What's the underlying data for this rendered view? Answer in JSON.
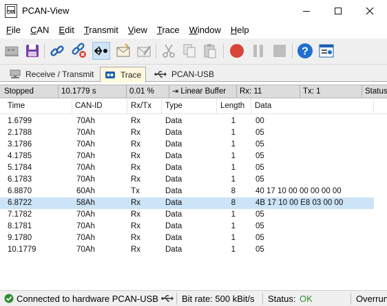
{
  "window": {
    "title": "PCAN-View",
    "app_icon_text": "CAN"
  },
  "menu": [
    {
      "label_u": "F",
      "label_rest": "ile"
    },
    {
      "label_u": "C",
      "label_rest": "AN"
    },
    {
      "label_u": "E",
      "label_rest": "dit"
    },
    {
      "label_u": "T",
      "label_rest": "ransmit"
    },
    {
      "label_u": "V",
      "label_rest": "iew"
    },
    {
      "label_u": "T",
      "label_rest": "race"
    },
    {
      "label_u": "W",
      "label_rest": "indow"
    },
    {
      "label_u": "H",
      "label_rest": "elp"
    }
  ],
  "tabs": {
    "receive_transmit": "Receive / Transmit",
    "trace": "Trace",
    "pcan_usb": "PCAN-USB"
  },
  "trace_status": {
    "state": "Stopped",
    "elapsed": "10.1779 s",
    "buffer_usage": "0.01 %",
    "buffer_mode": "Linear Buffer",
    "rx": "Rx: 11",
    "tx": "Tx: 1",
    "status": "Status"
  },
  "table": {
    "headers": {
      "time": "Time",
      "can_id": "CAN-ID",
      "rx_tx": "Rx/Tx",
      "type": "Type",
      "length": "Length",
      "data": "Data"
    },
    "rows": [
      {
        "time": "1.6799",
        "id": "70Ah",
        "dir": "Rx",
        "type": "Data",
        "len": "1",
        "data": "00"
      },
      {
        "time": "2.1788",
        "id": "70Ah",
        "dir": "Rx",
        "type": "Data",
        "len": "1",
        "data": "05"
      },
      {
        "time": "3.1786",
        "id": "70Ah",
        "dir": "Rx",
        "type": "Data",
        "len": "1",
        "data": "05"
      },
      {
        "time": "4.1785",
        "id": "70Ah",
        "dir": "Rx",
        "type": "Data",
        "len": "1",
        "data": "05"
      },
      {
        "time": "5.1784",
        "id": "70Ah",
        "dir": "Rx",
        "type": "Data",
        "len": "1",
        "data": "05"
      },
      {
        "time": "6.1783",
        "id": "70Ah",
        "dir": "Rx",
        "type": "Data",
        "len": "1",
        "data": "05"
      },
      {
        "time": "6.8870",
        "id": "60Ah",
        "dir": "Tx",
        "type": "Data",
        "len": "8",
        "data": "40 17 10 00 00 00 00 00"
      },
      {
        "time": "6.8722",
        "id": "58Ah",
        "dir": "Rx",
        "type": "Data",
        "len": "8",
        "data": "4B 17 10 00 E8 03 00 00"
      },
      {
        "time": "7.1782",
        "id": "70Ah",
        "dir": "Rx",
        "type": "Data",
        "len": "1",
        "data": "05"
      },
      {
        "time": "8.1781",
        "id": "70Ah",
        "dir": "Rx",
        "type": "Data",
        "len": "1",
        "data": "05"
      },
      {
        "time": "9.1780",
        "id": "70Ah",
        "dir": "Rx",
        "type": "Data",
        "len": "1",
        "data": "05"
      },
      {
        "time": "10.1779",
        "id": "70Ah",
        "dir": "Rx",
        "type": "Data",
        "len": "1",
        "data": "05"
      }
    ],
    "selected_index": 7
  },
  "statusbar": {
    "connection": "Connected to hardware PCAN-USB",
    "bitrate": "Bit rate: 500 kBit/s",
    "status_label": "Status:",
    "status_value": "OK",
    "overrun": "Overrun"
  },
  "colors": {
    "selected_row": "#cce4f7",
    "active_tab": "#fff7de",
    "record": "#d9443a",
    "status_ok": "#2e8b2e",
    "help": "#1f6fd0"
  },
  "icons": [
    "connect-icon",
    "save-icon",
    "link-icon",
    "disconnect-icon",
    "rx-tx-icon",
    "new-message-icon",
    "edit-message-icon",
    "cut-icon",
    "copy-icon",
    "paste-icon",
    "record-icon",
    "pause-icon",
    "stop-icon",
    "help-icon",
    "properties-icon",
    "usb-icon",
    "connected-check-icon"
  ]
}
